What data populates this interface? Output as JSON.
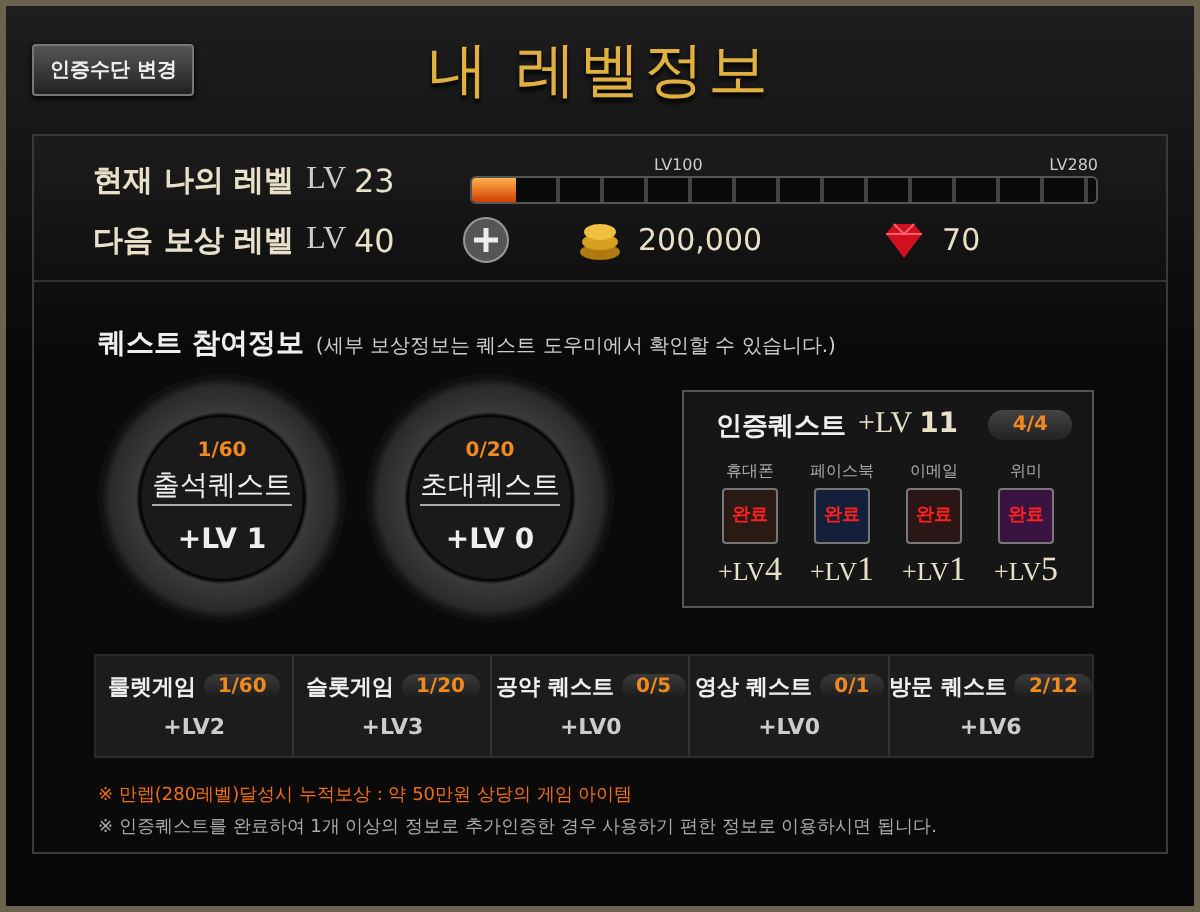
{
  "change_auth_button": "인증수단 변경",
  "title": "내 레벨정보",
  "level_rows": [
    {
      "label": "현재 나의 레벨",
      "lv_prefix": "LV",
      "value": "23"
    },
    {
      "label": "다음 보상 레벨",
      "lv_prefix": "LV",
      "value": "40"
    }
  ],
  "progress": {
    "level": 0.07,
    "ticks": [
      "LV100",
      "LV280"
    ]
  },
  "rewards": {
    "coins": "200,000",
    "gems": "70"
  },
  "quest_section": {
    "title": "퀘스트 참여정보",
    "note": "(세부 보상정보는 퀘스트 도우미에서 확인할 수 있습니다.)"
  },
  "ring_quests": [
    {
      "count": "1/60",
      "name": "출석퀘스트",
      "reward": "+LV 1"
    },
    {
      "count": "0/20",
      "name": "초대퀘스트",
      "reward": "+LV 0"
    }
  ],
  "auth_quest": {
    "title": "인증퀘스트",
    "bonus_prefix": "+LV",
    "bonus": "11",
    "count": "4/4",
    "items": [
      {
        "kind": "phone",
        "name": "휴대폰",
        "status": "완료",
        "reward_prefix": "+LV",
        "reward": "4"
      },
      {
        "kind": "facebook",
        "name": "페이스북",
        "status": "완료",
        "reward_prefix": "+LV",
        "reward": "1"
      },
      {
        "kind": "email",
        "name": "이메일",
        "status": "완료",
        "reward_prefix": "+LV",
        "reward": "1"
      },
      {
        "kind": "wimi",
        "name": "위미",
        "status": "완료",
        "reward_prefix": "+LV",
        "reward": "5"
      }
    ]
  },
  "small_quests": [
    {
      "name": "룰렛게임",
      "count": "1/60",
      "reward": "+LV2"
    },
    {
      "name": "슬롯게임",
      "count": "1/20",
      "reward": "+LV3"
    },
    {
      "name": "공약 퀘스트",
      "count": "0/5",
      "reward": "+LV0"
    },
    {
      "name": "영상 퀘스트",
      "count": "0/1",
      "reward": "+LV0"
    },
    {
      "name": "방문 퀘스트",
      "count": "2/12",
      "reward": "+LV6"
    }
  ],
  "notes": [
    "※ 만렙(280레벨)달성시 누적보상 : 약 50만원 상당의 게임 아이템",
    "※ 인증퀘스트를 완료하여 1개 이상의 정보로 추가인증한 경우 사용하기 편한 정보로 이용하시면 됩니다."
  ]
}
